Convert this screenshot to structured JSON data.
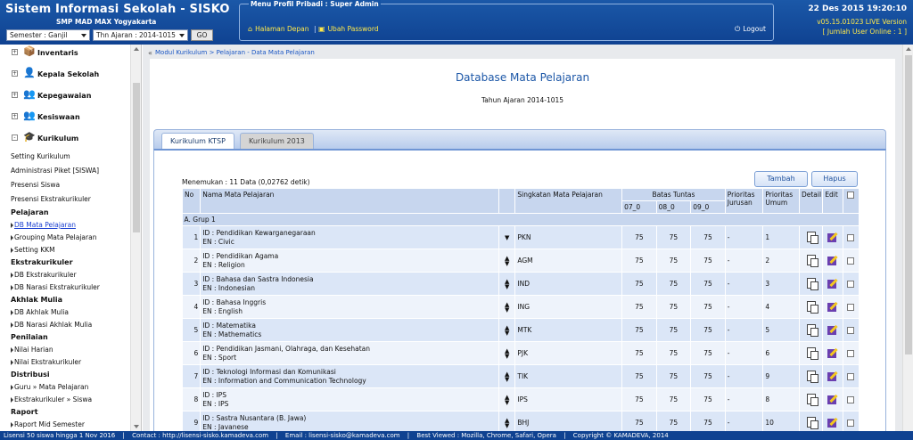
{
  "header": {
    "app_title": "Sistem Informasi Sekolah - SISKO",
    "school": "SMP MAD MAX Yogyakarta",
    "semester_select": "Semester : Ganjil",
    "year_select": "Thn Ajaran : 2014-1015",
    "go_label": "GO",
    "menu_title": "Menu Profil Pribadi : Super Admin",
    "home_label": "Halaman Depan",
    "separator": "|",
    "password_label": "Ubah Password",
    "logout_label": "Logout",
    "datetime": "22 Des 2015 19:20:10",
    "version": "v05.15.01023 LIVE Version",
    "online_users": "[ Jumlah User Online : 1 ]"
  },
  "sidebar": {
    "groups": [
      {
        "label": "Inventaris",
        "toggle": "+",
        "icon": "inventory-icon"
      },
      {
        "label": "Kepala Sekolah",
        "toggle": "+",
        "icon": "principal-icon"
      },
      {
        "label": "Kepegawaian",
        "toggle": "+",
        "icon": "staff-icon"
      },
      {
        "label": "Kesiswaan",
        "toggle": "+",
        "icon": "students-icon"
      },
      {
        "label": "Kurikulum",
        "toggle": "-",
        "icon": "curriculum-icon"
      }
    ],
    "links": {
      "setting_kurikulum": "Setting Kurikulum",
      "administrasi_piket": "Administrasi Piket [SISWA]",
      "presensi_siswa": "Presensi Siswa",
      "presensi_ekstra": "Presensi Ekstrakurikuler"
    },
    "sections": {
      "pelajaran": "Pelajaran",
      "ekstrakurikuler": "Ekstrakurikuler",
      "akhlak": "Akhlak Mulia",
      "penilaian": "Penilaian",
      "distribusi": "Distribusi",
      "raport": "Raport"
    },
    "pelajaran_items": [
      "DB Mata Pelajaran",
      "Grouping Mata Pelajaran",
      "Setting KKM"
    ],
    "ekstra_items": [
      "DB Ekstrakurikuler",
      "DB Narasi Ekstrakurikuler"
    ],
    "akhlak_items": [
      "DB Akhlak Mulia",
      "DB Narasi Akhlak Mulia"
    ],
    "penilaian_items": [
      "Nilai Harian",
      "Nilai Ekstrakurikuler"
    ],
    "distribusi_items": [
      "Guru » Mata Pelajaran",
      "Ekstrakurikuler » Siswa"
    ],
    "raport_items": [
      "Raport Mid Semester"
    ]
  },
  "main": {
    "breadcrumb": "Modul Kurikulum > Pelajaran - Data Mata Pelajaran",
    "title": "Database Mata Pelajaran",
    "year_line": "Tahun Ajaran 2014-1015",
    "tabs": [
      "Kurikulum KTSP",
      "Kurikulum 2013"
    ],
    "found": "Menemukan : 11 Data (0,02762 detik)",
    "add_label": "Tambah",
    "delete_label": "Hapus"
  },
  "table": {
    "headers": {
      "no": "No",
      "name": "Nama Mata Pelajaran",
      "abbr": "Singkatan Mata Pelajaran",
      "kkm": "Batas Tuntas",
      "kkm_cols": [
        "07_0",
        "08_0",
        "09_0"
      ],
      "prio_major": "Prioritas Jurusan",
      "prio_general": "Prioritas Umum",
      "detail": "Detail",
      "edit": "Edit"
    },
    "group": "A. Grup 1",
    "rows": [
      {
        "no": "1",
        "id": "ID : Pendidikan Kewarganegaraan",
        "en": "EN : Civic",
        "sort": "down",
        "abbr": "PKN",
        "k7": "75",
        "k8": "75",
        "k9": "75",
        "pj": "-",
        "pu": "1"
      },
      {
        "no": "2",
        "id": "ID : Pendidikan Agama",
        "en": "EN : Religion",
        "sort": "both",
        "abbr": "AGM",
        "k7": "75",
        "k8": "75",
        "k9": "75",
        "pj": "-",
        "pu": "2"
      },
      {
        "no": "3",
        "id": "ID : Bahasa dan Sastra Indonesia",
        "en": "EN : Indonesian",
        "sort": "both",
        "abbr": "IND",
        "k7": "75",
        "k8": "75",
        "k9": "75",
        "pj": "-",
        "pu": "3"
      },
      {
        "no": "4",
        "id": "ID : Bahasa Inggris",
        "en": "EN : English",
        "sort": "both",
        "abbr": "ING",
        "k7": "75",
        "k8": "75",
        "k9": "75",
        "pj": "-",
        "pu": "4"
      },
      {
        "no": "5",
        "id": "ID : Matematika",
        "en": "EN : Mathematics",
        "sort": "both",
        "abbr": "MTK",
        "k7": "75",
        "k8": "75",
        "k9": "75",
        "pj": "-",
        "pu": "5"
      },
      {
        "no": "6",
        "id": "ID : Pendidikan Jasmani, Olahraga, dan Kesehatan",
        "en": "EN : Sport",
        "sort": "both",
        "abbr": "PJK",
        "k7": "75",
        "k8": "75",
        "k9": "75",
        "pj": "-",
        "pu": "6"
      },
      {
        "no": "7",
        "id": "ID : Teknologi Informasi dan Komunikasi",
        "en": "EN : Information and Communication Technology",
        "sort": "both",
        "abbr": "TIK",
        "k7": "75",
        "k8": "75",
        "k9": "75",
        "pj": "-",
        "pu": "9"
      },
      {
        "no": "8",
        "id": "ID : IPS",
        "en": "EN : IPS",
        "sort": "both",
        "abbr": "IPS",
        "k7": "75",
        "k8": "75",
        "k9": "75",
        "pj": "-",
        "pu": "8"
      },
      {
        "no": "9",
        "id": "ID : Sastra Nusantara (B. Jawa)",
        "en": "EN : Javanese",
        "sort": "both",
        "abbr": "BHJ",
        "k7": "75",
        "k8": "75",
        "k9": "75",
        "pj": "-",
        "pu": "10"
      }
    ]
  },
  "footer": {
    "license": "Lisensi 50 siswa hingga 1 Nov 2016",
    "contact": "Contact : http://lisensi-sisko.kamadeva.com",
    "email": "Email : lisensi-sisko@kamadeva.com",
    "browsers": "Best Viewed : Mozilla, Chrome, Safari, Opera",
    "copyright": "Copyright © KAMADEVA, 2014",
    "separator": "|"
  },
  "colors": {
    "header": "#1654a4",
    "accent_text": "#ffe94a",
    "table_header": "#c7d6ee",
    "title": "#1c57a7"
  }
}
